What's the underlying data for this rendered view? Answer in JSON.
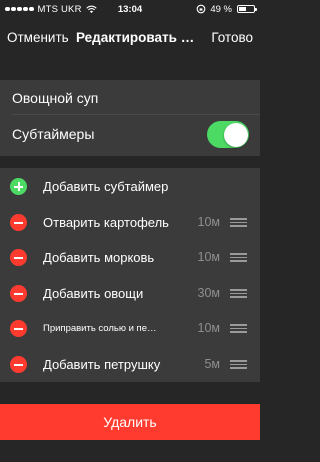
{
  "status_bar": {
    "carrier": "MTS UKR",
    "time": "13:04",
    "battery_percent": "49 %",
    "battery_level": 0.49
  },
  "nav": {
    "cancel_label": "Отменить",
    "title": "Редактировать таймер",
    "done_label": "Готово"
  },
  "settings": {
    "name": "Овощной суп",
    "subtimers_label": "Субтаймеры",
    "subtimers_enabled": true
  },
  "add_subtimer_label": "Добавить субтаймер",
  "subtimers": [
    {
      "label": "Отварить картофель",
      "duration": "10м"
    },
    {
      "label": "Добавить морковь",
      "duration": "10м"
    },
    {
      "label": "Добавить овощи",
      "duration": "30м"
    },
    {
      "label": "Приправить солью и перцем",
      "duration": "10м"
    },
    {
      "label": "Добавить петрушку",
      "duration": "5м"
    }
  ],
  "delete_label": "Удалить",
  "colors": {
    "accent_red": "#ff3b30",
    "accent_green": "#4cd964",
    "section_bg": "#3b3b3b",
    "page_bg": "#262626"
  }
}
